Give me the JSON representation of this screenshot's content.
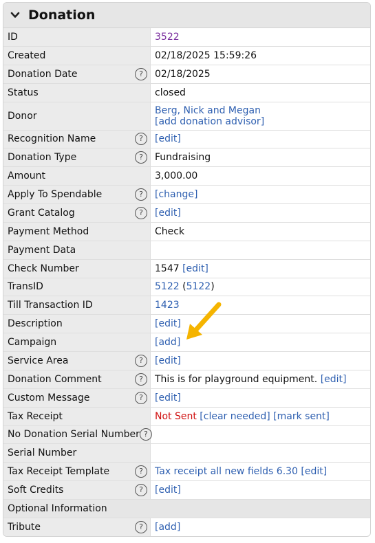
{
  "panel": {
    "title": "Donation",
    "chevron_icon": "chevron-down-icon"
  },
  "rows": [
    {
      "label": "ID",
      "help": false,
      "value": [
        {
          "text": "3522",
          "style": "purple"
        }
      ]
    },
    {
      "label": "Created",
      "help": false,
      "value": [
        {
          "text": "02/18/2025 15:59:26"
        }
      ]
    },
    {
      "label": "Donation Date",
      "help": true,
      "value": [
        {
          "text": "02/18/2025"
        }
      ]
    },
    {
      "label": "Status",
      "help": false,
      "value": [
        {
          "text": "closed"
        }
      ]
    },
    {
      "label": "Donor",
      "help": false,
      "value": [
        {
          "text": "Berg, Nick and Megan",
          "style": "link"
        }
      ],
      "value2": [
        {
          "text": "[add donation advisor]",
          "style": "link"
        }
      ]
    },
    {
      "label": "Recognition Name",
      "help": true,
      "value": [
        {
          "text": "[edit]",
          "style": "link"
        }
      ]
    },
    {
      "label": "Donation Type",
      "help": true,
      "value": [
        {
          "text": "Fundraising"
        }
      ]
    },
    {
      "label": "Amount",
      "help": false,
      "value": [
        {
          "text": "3,000.00"
        }
      ]
    },
    {
      "label": "Apply To Spendable",
      "help": true,
      "value": [
        {
          "text": "[change]",
          "style": "link"
        }
      ]
    },
    {
      "label": "Grant Catalog",
      "help": true,
      "value": [
        {
          "text": "[edit]",
          "style": "link"
        }
      ]
    },
    {
      "label": "Payment Method",
      "help": false,
      "value": [
        {
          "text": "Check"
        }
      ]
    },
    {
      "label": "Payment Data",
      "help": false,
      "value": []
    },
    {
      "label": "Check Number",
      "help": false,
      "value": [
        {
          "text": "1547 "
        },
        {
          "text": "[edit]",
          "style": "link"
        }
      ]
    },
    {
      "label": "TransID",
      "help": false,
      "value": [
        {
          "text": "5122",
          "style": "link"
        },
        {
          "text": " ("
        },
        {
          "text": "5122",
          "style": "link"
        },
        {
          "text": ")"
        }
      ]
    },
    {
      "label": "Till Transaction ID",
      "help": false,
      "value": [
        {
          "text": "1423",
          "style": "link"
        }
      ]
    },
    {
      "label": "Description",
      "help": false,
      "value": [
        {
          "text": "[edit]",
          "style": "link"
        }
      ]
    },
    {
      "label": "Campaign",
      "help": false,
      "value": [
        {
          "text": "[add]",
          "style": "link"
        }
      ]
    },
    {
      "label": "Service Area",
      "help": true,
      "value": [
        {
          "text": "[edit]",
          "style": "link"
        }
      ]
    },
    {
      "label": "Donation Comment",
      "help": true,
      "value": [
        {
          "text": "This is for playground equipment. "
        },
        {
          "text": "[edit]",
          "style": "link"
        }
      ]
    },
    {
      "label": "Custom Message",
      "help": true,
      "value": [
        {
          "text": "[edit]",
          "style": "link"
        }
      ]
    },
    {
      "label": "Tax Receipt",
      "help": false,
      "value": [
        {
          "text": "Not Sent ",
          "style": "red"
        },
        {
          "text": "[clear needed]",
          "style": "link"
        },
        {
          "text": " "
        },
        {
          "text": "[mark sent]",
          "style": "link"
        }
      ]
    },
    {
      "label": "No Donation Serial Number",
      "help": true,
      "value": []
    },
    {
      "label": "Serial Number",
      "help": false,
      "value": []
    },
    {
      "label": "Tax Receipt Template",
      "help": true,
      "value": [
        {
          "text": "Tax receipt all new fields 6.30",
          "style": "link"
        },
        {
          "text": " "
        },
        {
          "text": "[edit]",
          "style": "link"
        }
      ]
    },
    {
      "label": "Soft Credits",
      "help": true,
      "value": [
        {
          "text": "[edit]",
          "style": "link"
        }
      ]
    }
  ],
  "section": {
    "label": "Optional Information"
  },
  "after_rows": [
    {
      "label": "Tribute",
      "help": true,
      "value": [
        {
          "text": "[add]",
          "style": "link"
        }
      ]
    }
  ],
  "help_glyph": "?",
  "colors": {
    "link": "#2e5fb0",
    "id": "#7a2e9e",
    "not_sent": "#d01010",
    "arrow": "#f5b400"
  }
}
